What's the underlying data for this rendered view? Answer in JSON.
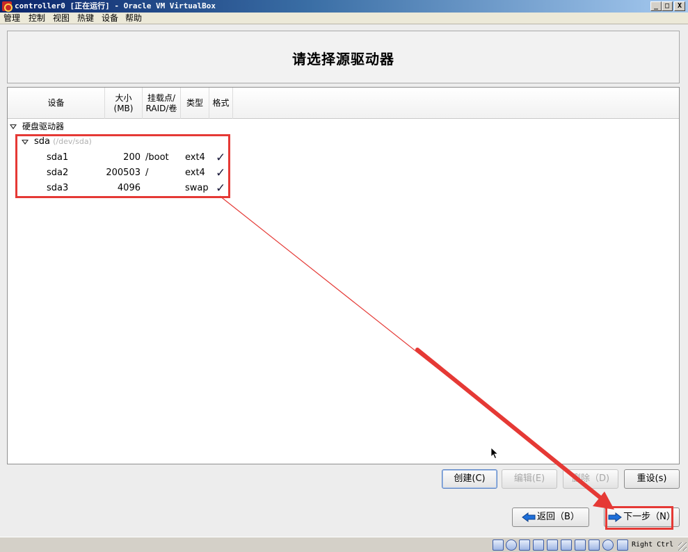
{
  "window": {
    "title": "controller0 [正在运行] - Oracle VM VirtualBox",
    "min_label": "_",
    "max_label": "□",
    "close_label": "X"
  },
  "menubar": {
    "items": [
      "管理",
      "控制",
      "视图",
      "热键",
      "设备",
      "帮助"
    ]
  },
  "header": {
    "title": "请选择源驱动器"
  },
  "table": {
    "columns": [
      {
        "line1": "设备",
        "line2": ""
      },
      {
        "line1": "大小",
        "line2": "(MB)"
      },
      {
        "line1": "挂载点/",
        "line2": "RAID/卷"
      },
      {
        "line1": "类型",
        "line2": ""
      },
      {
        "line1": "格式",
        "line2": ""
      }
    ],
    "group": "硬盘驱动器",
    "disk": {
      "name": "sda",
      "path": "(/dev/sda)"
    },
    "partitions": [
      {
        "name": "sda1",
        "size": "200",
        "mount": "/boot",
        "type": "ext4",
        "format": "✓"
      },
      {
        "name": "sda2",
        "size": "200503",
        "mount": "/",
        "type": "ext4",
        "format": "✓"
      },
      {
        "name": "sda3",
        "size": "4096",
        "mount": "",
        "type": "swap",
        "format": "✓"
      }
    ]
  },
  "actions": {
    "create": "创建(C)",
    "edit": "编辑(E)",
    "delete": "删除（D)",
    "reset": "重设(s)"
  },
  "nav": {
    "back": "返回（B）",
    "next": "下一步（N）"
  },
  "statusbar": {
    "host_key": "Right Ctrl",
    "icons": [
      "hard-disk-icon",
      "optical-drive-icon",
      "network-icon",
      "usb-icon",
      "shared-folder-icon",
      "display-icon",
      "screen-capture-icon",
      "video-capture-icon",
      "cpu-icon",
      "mouse-integration-icon",
      "keyboard-icon"
    ]
  },
  "colors": {
    "annotation": "#e53935",
    "title_bar": "#0a246a",
    "next_arrow": "#1e6fd9"
  }
}
